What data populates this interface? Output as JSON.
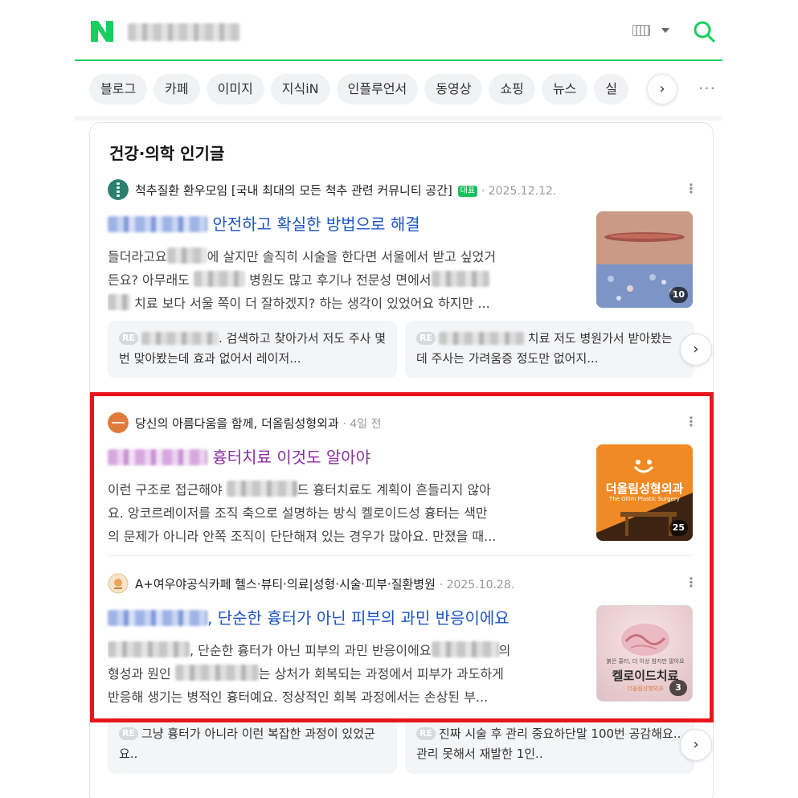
{
  "header": {
    "logo_letter": "N",
    "search_button_label": "검색",
    "colors": {
      "brand": "#19ce60",
      "link": "#1c53c4",
      "visited": "#8a2ea0",
      "highlight": "#e8151b"
    }
  },
  "tabs": {
    "items": [
      "블로그",
      "카페",
      "이미지",
      "지식iN",
      "인플루언서",
      "동영상",
      "쇼핑",
      "뉴스",
      "실"
    ],
    "next_label": "›",
    "more_label": "···"
  },
  "section": {
    "title": "건강·의학 인기글",
    "posts": [
      {
        "source": "척추질환 환우모임 [국내 최대의 모든 척추 관련 커뮤니티 공간]",
        "badge": "대표",
        "date": "· 2025.12.12.",
        "title": "안전하고 확실한 방법으로 해결",
        "snippet_1a": "들더라고요",
        "snippet_1b": "에 살지만 솔직히 시술을 한다면 서울에서 받고 싶었거",
        "snippet_2a": "든요? 아무래도",
        "snippet_2b": "병원도 많고 후기나 전문성 면에서",
        "snippet_3": "치료 보다 서울 쪽이 더 잘하겠지? 하는 생각이 있었어요 하지만 ...",
        "image_count": "10",
        "replies": [
          {
            "tag": "RE",
            "text": ". 검색하고 찾아가서 저도 주사 몇번 맞아봤는데 효과 없어서 레이저..."
          },
          {
            "tag": "RE",
            "text": "치료 저도 병원가서 받아봤는데 주사는 가려움증 정도만 없어지..."
          }
        ]
      },
      {
        "source": "당신의 아름다움을 함께, 더올림성형외과",
        "date": "· 4일 전",
        "title": "흉터치료 이것도 알아야",
        "snippet_1a": "이런 구조로 접근해야",
        "snippet_1b": "드 흉터치료도 계획이 흔들리지 않아",
        "snippet_2": "요. 앙코르레이저를 조직 축으로 설명하는 방식 켈로이드성 흉터는 색만",
        "snippet_3": "의 문제가 아니라 안쪽 조직이 단단해져 있는 경우가 많아요. 만졌을 때...",
        "thumb_text": "더올림성형외과",
        "thumb_sub": "The Ollim Plastic Surgery",
        "image_count": "25"
      },
      {
        "source": "A+여우야공식카페 헬스·뷰티·의료|성형·시술·피부·질환병원",
        "date": "· 2025.10.28.",
        "title": ", 단순한 흉터가 아닌 피부의 과민 반응이에요",
        "snippet_1": ", 단순한 흉터가 아닌 피부의 과민 반응이에요",
        "snippet_1b": "의",
        "snippet_2a": "형성과 원인",
        "snippet_2b": "는 상처가 회복되는 과정에서 피부가 과도하게",
        "snippet_3": "반응해 생기는 병적인 흉터예요. 정상적인 회복 과정에서는 손상된 부...",
        "thumb_top": "붉은 흉터, 더 이상 참지만 말아요",
        "thumb_text": "켈로이드치료",
        "thumb_brand": "더올림성형외과",
        "image_count": "3",
        "replies": [
          {
            "tag": "RE",
            "text": "그냥 흉터가 아니라 이런 복잡한 과정이 있었군요.."
          },
          {
            "tag": "RE",
            "text": "진짜 시술 후 관리 중요하단말 100번 공감해요.. 관리 못해서 재발한 1인.."
          }
        ]
      }
    ]
  }
}
